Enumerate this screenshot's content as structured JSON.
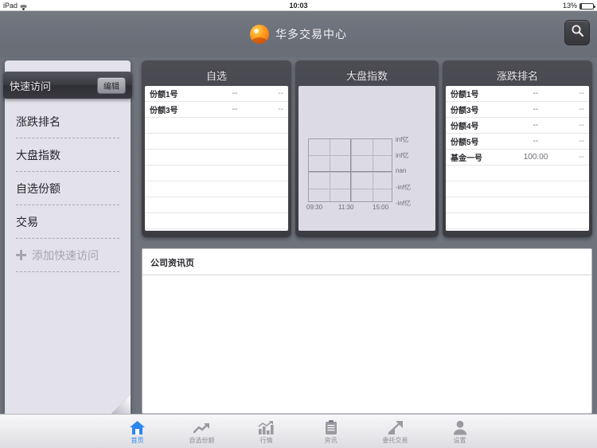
{
  "statusbar": {
    "carrier": "iPad",
    "wifi_icon": "wifi-icon",
    "time": "10:03",
    "battery_pct": "13%",
    "battery_level": 13
  },
  "topnav": {
    "logo_icon": "app-logo-icon",
    "title": "华多交易中心",
    "search_icon": "search-icon"
  },
  "sidebar": {
    "header_title": "快速访问",
    "edit_label": "编辑",
    "items": [
      {
        "label": "涨跌排名"
      },
      {
        "label": "大盘指数"
      },
      {
        "label": "自选份额"
      },
      {
        "label": "交易"
      }
    ],
    "add_label": "添加快速访问",
    "add_icon": "plus-icon"
  },
  "panels": [
    {
      "title": "自选",
      "rows": [
        {
          "name": "份额1号",
          "value": "--",
          "change": "--"
        },
        {
          "name": "份额3号",
          "value": "--",
          "change": "--"
        }
      ],
      "empty_rows": 8
    },
    {
      "title": "大盘指数",
      "type": "chart"
    },
    {
      "title": "涨跌排名",
      "rows": [
        {
          "name": "份额1号",
          "value": "--",
          "change": "--"
        },
        {
          "name": "份额3号",
          "value": "--",
          "change": "--"
        },
        {
          "name": "份额4号",
          "value": "--",
          "change": "--"
        },
        {
          "name": "份额5号",
          "value": "--",
          "change": "--"
        },
        {
          "name": "基金一号",
          "value": "100.00",
          "change": "--"
        }
      ],
      "empty_rows": 5
    }
  ],
  "chart_data": {
    "type": "line",
    "title": "大盘指数",
    "xlabel": "",
    "ylabel": "",
    "x_ticks": [
      "09:30",
      "11:30",
      "15:00"
    ],
    "y_ticks": [
      "inf亿",
      "inf亿",
      "nan",
      "-inf亿",
      "-inf亿"
    ],
    "series": [
      {
        "name": "大盘指数",
        "values": []
      }
    ],
    "grid": true,
    "legend": "none",
    "note": "empty plot — no data plotted, axes show inf / nan placeholders"
  },
  "news": {
    "title": "公司资讯页",
    "body": ""
  },
  "tabbar": {
    "active_index": 0,
    "accent_color": "#2b86f0",
    "tabs": [
      {
        "label": "首页",
        "icon": "home-icon"
      },
      {
        "label": "自选份额",
        "icon": "trend-arrow-icon"
      },
      {
        "label": "行情",
        "icon": "bar-chart-icon"
      },
      {
        "label": "资讯",
        "icon": "clipboard-icon"
      },
      {
        "label": "委托交易",
        "icon": "exchange-arrows-icon"
      },
      {
        "label": "设置",
        "icon": "person-icon"
      }
    ]
  }
}
